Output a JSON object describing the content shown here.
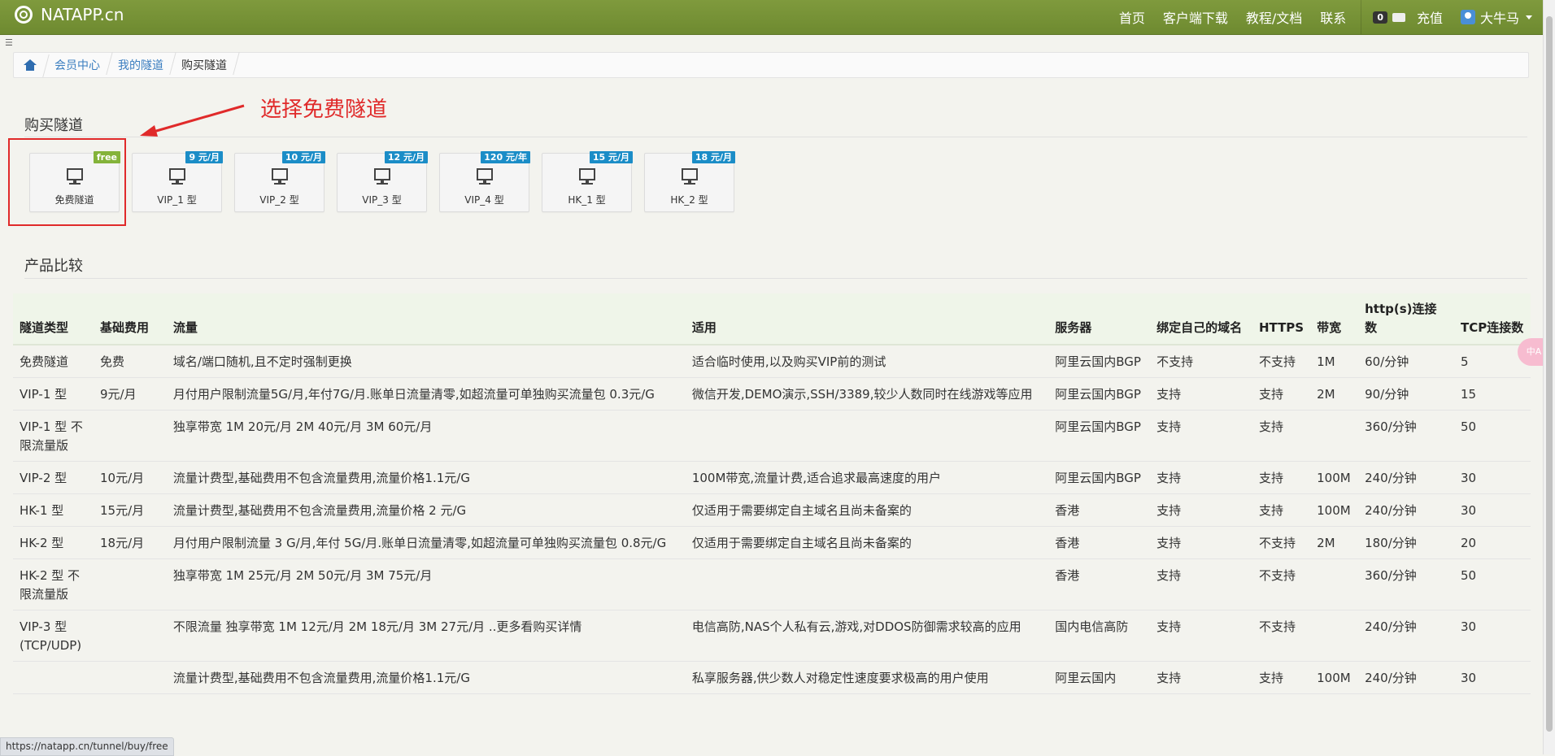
{
  "navbar": {
    "brand": "NATAPP.cn",
    "links": [
      "首页",
      "客户端下载",
      "教程/文档",
      "联系"
    ],
    "balance": "0",
    "recharge": "充值",
    "username": "大牛马"
  },
  "breadcrumb": {
    "items": [
      "会员中心",
      "我的隧道",
      "购买隧道"
    ]
  },
  "annotation": "选择免费隧道",
  "buy_section": {
    "title": "购买隧道",
    "tiles": [
      {
        "label": "免费隧道",
        "badge": "free"
      },
      {
        "label": "VIP_1 型",
        "badge": "9 元/月"
      },
      {
        "label": "VIP_2 型",
        "badge": "10 元/月"
      },
      {
        "label": "VIP_3 型",
        "badge": "12 元/月"
      },
      {
        "label": "VIP_4 型",
        "badge": "120 元/年"
      },
      {
        "label": "HK_1 型",
        "badge": "15 元/月"
      },
      {
        "label": "HK_2 型",
        "badge": "18 元/月"
      }
    ]
  },
  "compare_section": {
    "title": "产品比较",
    "headers": [
      "隧道类型",
      "基础费用",
      "流量",
      "适用",
      "服务器",
      "绑定自己的域名",
      "HTTPS",
      "带宽",
      "http(s)连接数",
      "TCP连接数"
    ],
    "rows": [
      [
        "免费隧道",
        "免费",
        "域名/端口随机,且不定时强制更换",
        "适合临时使用,以及购买VIP前的测试",
        "阿里云国内BGP",
        "不支持",
        "不支持",
        "1M",
        "60/分钟",
        "5"
      ],
      [
        "VIP-1 型",
        "9元/月",
        "月付用户限制流量5G/月,年付7G/月.账单日流量清零,如超流量可单独购买流量包 0.3元/G",
        "微信开发,DEMO演示,SSH/3389,较少人数同时在线游戏等应用",
        "阿里云国内BGP",
        "支持",
        "支持",
        "2M",
        "90/分钟",
        "15"
      ],
      [
        "VIP-1 型 不限流量版",
        "",
        "独享带宽 1M 20元/月 2M 40元/月 3M 60元/月",
        "",
        "阿里云国内BGP",
        "支持",
        "支持",
        "",
        "360/分钟",
        "50"
      ],
      [
        "VIP-2 型",
        "10元/月",
        "流量计费型,基础费用不包含流量费用,流量价格1.1元/G",
        "100M带宽,流量计费,适合追求最高速度的用户",
        "阿里云国内BGP",
        "支持",
        "支持",
        "100M",
        "240/分钟",
        "30"
      ],
      [
        "HK-1 型",
        "15元/月",
        "流量计费型,基础费用不包含流量费用,流量价格 2 元/G",
        "仅适用于需要绑定自主域名且尚未备案的",
        "香港",
        "支持",
        "支持",
        "100M",
        "240/分钟",
        "30"
      ],
      [
        "HK-2 型",
        "18元/月",
        "月付用户限制流量 3 G/月,年付 5G/月.账单日流量清零,如超流量可单独购买流量包 0.8元/G",
        "仅适用于需要绑定自主域名且尚未备案的",
        "香港",
        "支持",
        "不支持",
        "2M",
        "180/分钟",
        "20"
      ],
      [
        "HK-2 型 不限流量版",
        "",
        "独享带宽 1M 25元/月 2M 50元/月 3M 75元/月",
        "",
        "香港",
        "支持",
        "不支持",
        "",
        "360/分钟",
        "50"
      ],
      [
        "VIP-3 型 (TCP/UDP)",
        "",
        "不限流量 独享带宽 1M 12元/月 2M 18元/月 3M 27元/月 ..更多看购买详情",
        "电信高防,NAS个人私有云,游戏,对DDOS防御需求较高的应用",
        "国内电信高防",
        "支持",
        "不支持",
        "",
        "240/分钟",
        "30"
      ],
      [
        "",
        "",
        "流量计费型,基础费用不包含流量费用,流量价格1.1元/G",
        "私享服务器,供少数人对稳定性速度要求极高的用户使用",
        "阿里云国内",
        "支持",
        "支持",
        "100M",
        "240/分钟",
        "30"
      ]
    ]
  },
  "status_bar": "https://natapp.cn/tunnel/buy/free",
  "side_float": "中A",
  "colors": {
    "navbar": "#7a9537",
    "annotation": "#e02a2a",
    "badge_blue": "#1b8dc7",
    "badge_green": "#84b33a"
  }
}
